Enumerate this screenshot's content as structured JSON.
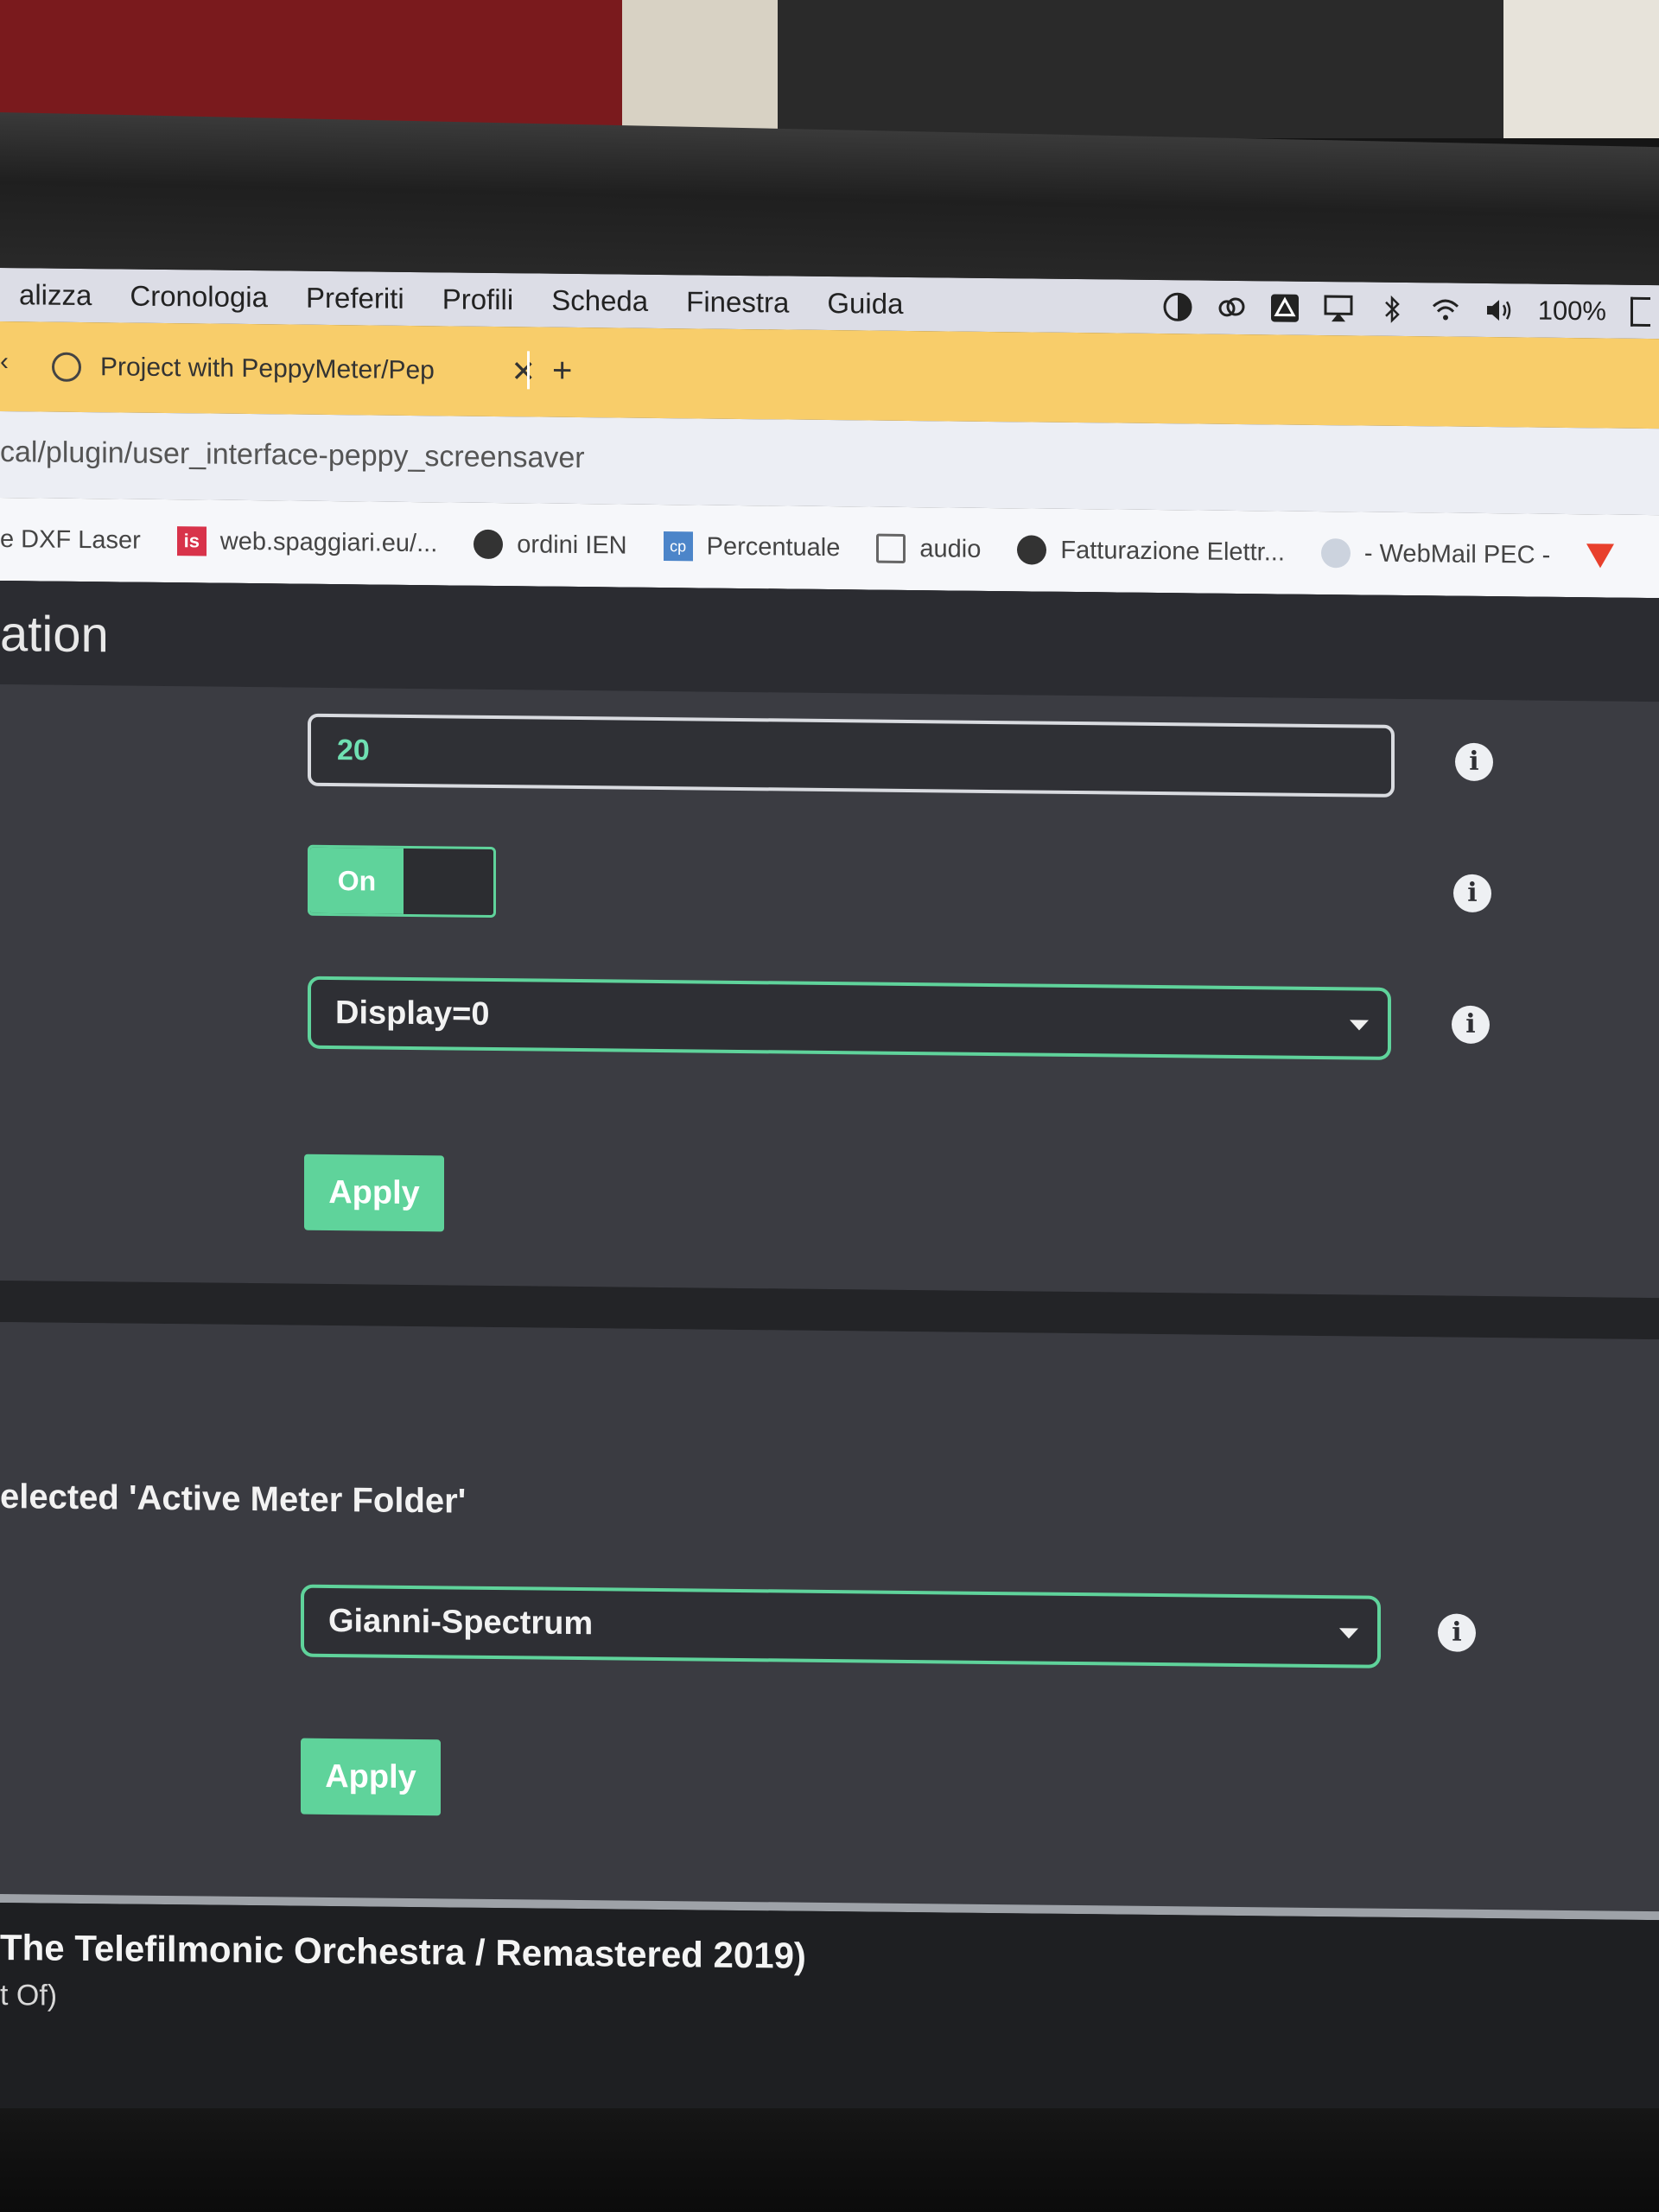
{
  "menubar": {
    "items": [
      "alizza",
      "Cronologia",
      "Preferiti",
      "Profili",
      "Scheda",
      "Finestra",
      "Guida"
    ],
    "battery": "100%"
  },
  "tabbar": {
    "arrow": "‹",
    "tab_title": "Project with PeppyMeter/Pep",
    "close": "✕",
    "new_tab": "+"
  },
  "url": "cal/plugin/user_interface-peppy_screensaver",
  "bookmarks": [
    {
      "label": "e DXF Laser",
      "icon": ""
    },
    {
      "label": "web.spaggiari.eu/...",
      "icon": "is"
    },
    {
      "label": "ordini IEN",
      "icon": "globe-icon"
    },
    {
      "label": "Percentuale",
      "icon": "cp"
    },
    {
      "label": "audio",
      "icon": "folder-icon"
    },
    {
      "label": "Fatturazione Elettr...",
      "icon": "globe-icon"
    },
    {
      "label": "- WebMail PEC -",
      "icon": "pec-icon"
    }
  ],
  "section": {
    "title": "ation"
  },
  "panel1": {
    "textbox_value": "20",
    "toggle_label": "On",
    "display_select": "Display=0",
    "apply": "Apply",
    "info": "i"
  },
  "panel2": {
    "label": "elected 'Active Meter Folder'",
    "folder_select": "Gianni-Spectrum",
    "apply": "Apply",
    "info": "i"
  },
  "footer": {
    "track_line1": "The Telefilmonic Orchestra / Remastered 2019)",
    "track_line2": "t Of)"
  },
  "colors": {
    "accent": "#5fd39b",
    "tabbar": "#f8cd6a",
    "panel": "#3b3c42"
  }
}
